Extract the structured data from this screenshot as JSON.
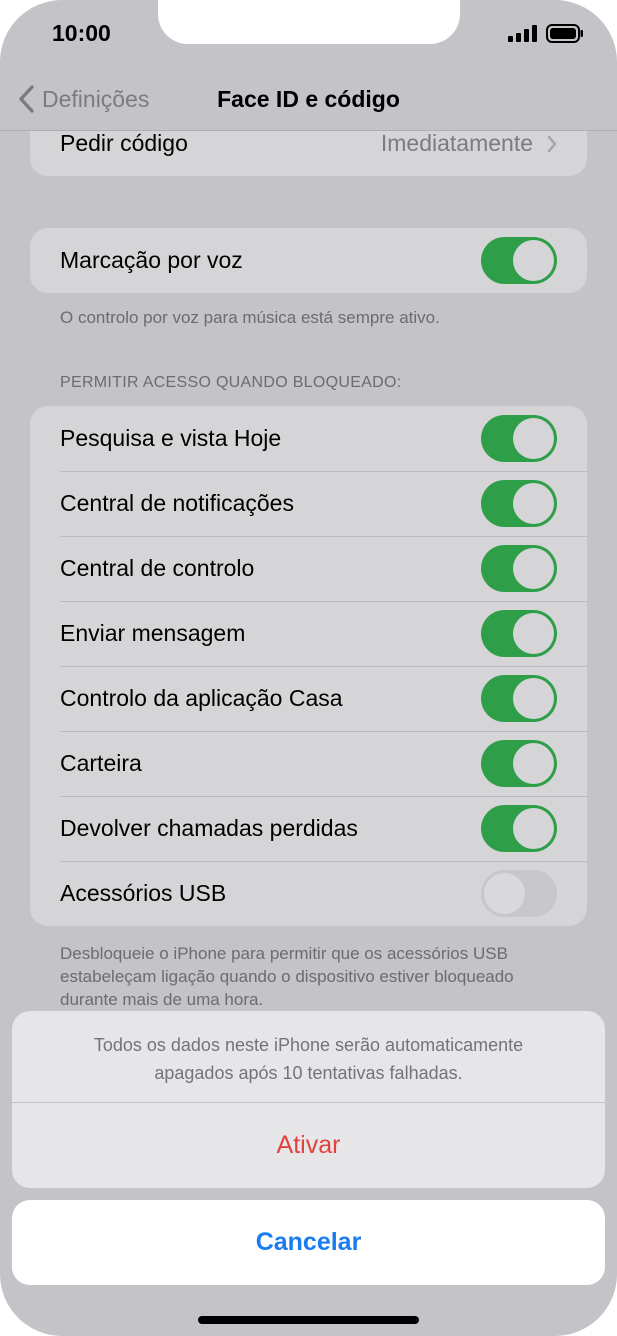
{
  "status_bar": {
    "time": "10:00"
  },
  "nav": {
    "back_label": "Definições",
    "title": "Face ID e código"
  },
  "passcode_row": {
    "label": "Pedir código",
    "value": "Imediatamente"
  },
  "voice_dial": {
    "label": "Marcação por voz",
    "on": true,
    "footnote": "O controlo por voz para música está sempre ativo."
  },
  "locked_access": {
    "header": "PERMITIR ACESSO QUANDO BLOQUEADO:",
    "items": [
      {
        "label": "Pesquisa e vista Hoje",
        "on": true
      },
      {
        "label": "Central de notificações",
        "on": true
      },
      {
        "label": "Central de controlo",
        "on": true
      },
      {
        "label": "Enviar mensagem",
        "on": true
      },
      {
        "label": "Controlo da aplicação Casa",
        "on": true
      },
      {
        "label": "Carteira",
        "on": true
      },
      {
        "label": "Devolver chamadas perdidas",
        "on": true
      },
      {
        "label": "Acessórios USB",
        "on": false
      }
    ],
    "footnote": "Desbloqueie o iPhone para permitir que os acessórios USB estabeleçam ligação quando o dispositivo estiver bloqueado durante mais de uma hora."
  },
  "action_sheet": {
    "message": "Todos os dados neste iPhone serão automaticamente apagados após 10 tentativas falhadas.",
    "action_label": "Ativar",
    "cancel_label": "Cancelar"
  },
  "colors": {
    "toggle_on": "#2f9e48",
    "destructive": "#e3413b",
    "link": "#1a7cf2"
  }
}
